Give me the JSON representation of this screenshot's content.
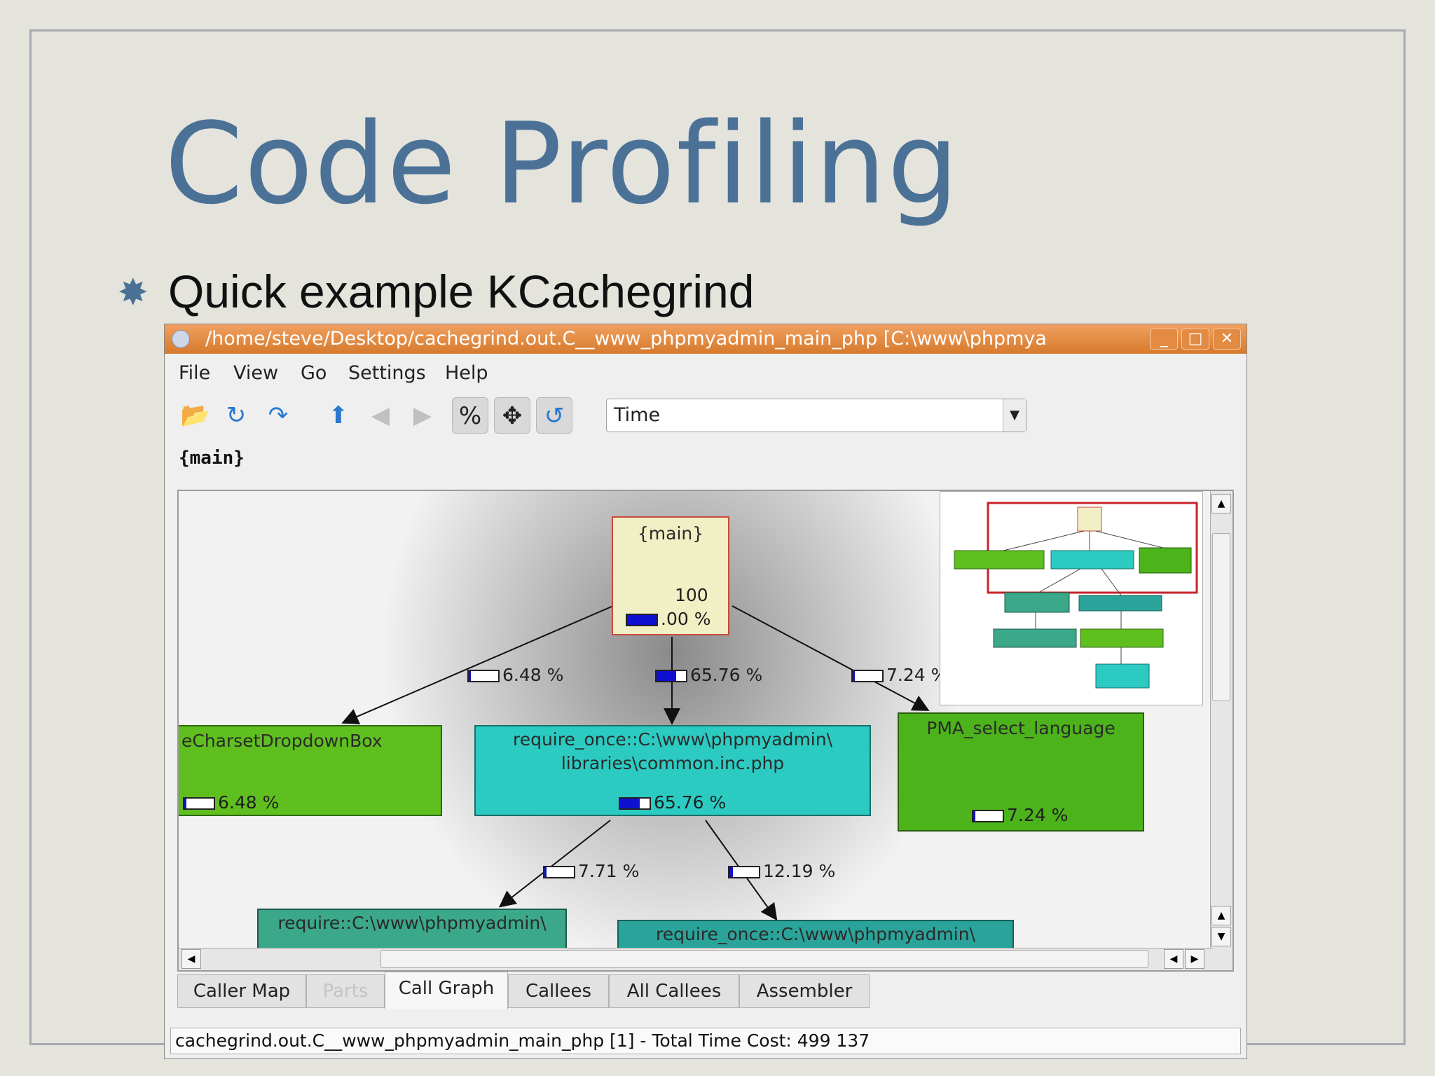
{
  "slide": {
    "title": "Code Profiling",
    "bullet": "Quick example KCachegrind"
  },
  "window": {
    "title": "/home/steve/Desktop/cachegrind.out.C__www_phpmyadmin_main_php [C:\\www\\phpmya",
    "controls": {
      "minimize": "_",
      "maximize": "□",
      "close": "✕"
    }
  },
  "menu": [
    "File",
    "View",
    "Go",
    "Settings",
    "Help"
  ],
  "toolbar": {
    "icons": [
      "open-icon",
      "reload-icon",
      "forward-arrow-icon",
      "up-icon",
      "back-icon",
      "next-icon",
      "percent-icon",
      "move-icon",
      "cycle-icon"
    ],
    "percent_label": "%",
    "event_type": "Time"
  },
  "current_function": "{main}",
  "graph": {
    "main": {
      "name": "{main}",
      "cost_line1": "100",
      "cost_line2": ".00 %",
      "fill": 1.0
    },
    "nodes": [
      {
        "name": "eCharsetDropdownBox",
        "pct": "6.48 %",
        "fill": 0.06,
        "color": "#5fbf1f"
      },
      {
        "name_line1": "require_once::C:\\www\\phpmyadmin\\",
        "name_line2": "libraries\\common.inc.php",
        "pct": "65.76 %",
        "fill": 0.66,
        "color": "#2ccbc2"
      },
      {
        "name": "PMA_select_language",
        "pct": "7.24 %",
        "fill": 0.07,
        "color": "#4cb31a"
      },
      {
        "name_line1": "require::C:\\www\\phpmyadmin\\",
        "color": "#3aa889"
      },
      {
        "name_line1": "require_once::C:\\www\\phpmyadmin\\",
        "color": "#2aa39a"
      }
    ],
    "edges": [
      {
        "pct": "6.48 %",
        "fill": 0.06
      },
      {
        "pct": "65.76 %",
        "fill": 0.66
      },
      {
        "pct": "7.24 %",
        "fill": 0.07
      },
      {
        "pct": "7.71 %",
        "fill": 0.08
      },
      {
        "pct": "12.19 %",
        "fill": 0.12
      }
    ]
  },
  "tabs": [
    "Caller Map",
    "Parts",
    "Call Graph",
    "Callees",
    "All Callees",
    "Assembler"
  ],
  "active_tab": "Call Graph",
  "status": "cachegrind.out.C__www_phpmyadmin_main_php [1] - Total Time Cost:  499 137"
}
